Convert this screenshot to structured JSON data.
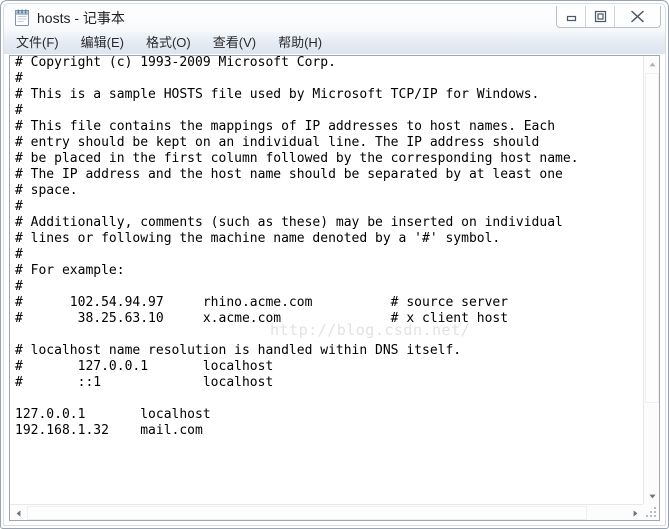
{
  "window": {
    "title": "hosts - 记事本",
    "icon": "notepad-icon",
    "controls": {
      "minimize_label": "最小化",
      "maximize_label": "最大化",
      "close_label": "关闭"
    }
  },
  "menubar": {
    "items": [
      {
        "label": "文件(F)",
        "name": "menu-file"
      },
      {
        "label": "编辑(E)",
        "name": "menu-edit"
      },
      {
        "label": "格式(O)",
        "name": "menu-format"
      },
      {
        "label": "查看(V)",
        "name": "menu-view"
      },
      {
        "label": "帮助(H)",
        "name": "menu-help"
      }
    ]
  },
  "editor": {
    "content": "# Copyright (c) 1993-2009 Microsoft Corp.\n#\n# This is a sample HOSTS file used by Microsoft TCP/IP for Windows.\n#\n# This file contains the mappings of IP addresses to host names. Each\n# entry should be kept on an individual line. The IP address should\n# be placed in the first column followed by the corresponding host name.\n# The IP address and the host name should be separated by at least one\n# space.\n#\n# Additionally, comments (such as these) may be inserted on individual\n# lines or following the machine name denoted by a '#' symbol.\n#\n# For example:\n#\n#      102.54.94.97     rhino.acme.com          # source server\n#       38.25.63.10     x.acme.com              # x client host\n\n# localhost name resolution is handled within DNS itself.\n#       127.0.0.1       localhost\n#       ::1             localhost\n\n127.0.0.1       localhost\n192.168.1.32    mail.com",
    "lines": [
      "# Copyright (c) 1993-2009 Microsoft Corp.",
      "#",
      "# This is a sample HOSTS file used by Microsoft TCP/IP for Windows.",
      "#",
      "# This file contains the mappings of IP addresses to host names. Each",
      "# entry should be kept on an individual line. The IP address should",
      "# be placed in the first column followed by the corresponding host name.",
      "# The IP address and the host name should be separated by at least one",
      "# space.",
      "#",
      "# Additionally, comments (such as these) may be inserted on individual",
      "# lines or following the machine name denoted by a '#' symbol.",
      "#",
      "# For example:",
      "#",
      "#      102.54.94.97     rhino.acme.com          # source server",
      "#       38.25.63.10     x.acme.com              # x client host",
      "",
      "# localhost name resolution is handled within DNS itself.",
      "#       127.0.0.1       localhost",
      "#       ::1             localhost",
      "",
      "127.0.0.1       localhost",
      "192.168.1.32    mail.com"
    ],
    "host_entries": [
      {
        "ip": "127.0.0.1",
        "hostname": "localhost"
      },
      {
        "ip": "192.168.1.32",
        "hostname": "mail.com"
      }
    ]
  },
  "watermark": {
    "text": "http://blog.csdn.net/"
  },
  "scrollbars": {
    "vertical": {
      "up_arrow": "scroll-up-icon",
      "down_arrow": "scroll-down-icon"
    },
    "horizontal": {
      "left_arrow": "scroll-left-icon",
      "right_arrow": "scroll-right-icon"
    }
  },
  "colors": {
    "titlebar": "#fbfcfd",
    "menubar": "#e4eaf3",
    "text": "#000000",
    "watermark": "#e2e2e4",
    "frame_border": "#9aa3ad"
  }
}
